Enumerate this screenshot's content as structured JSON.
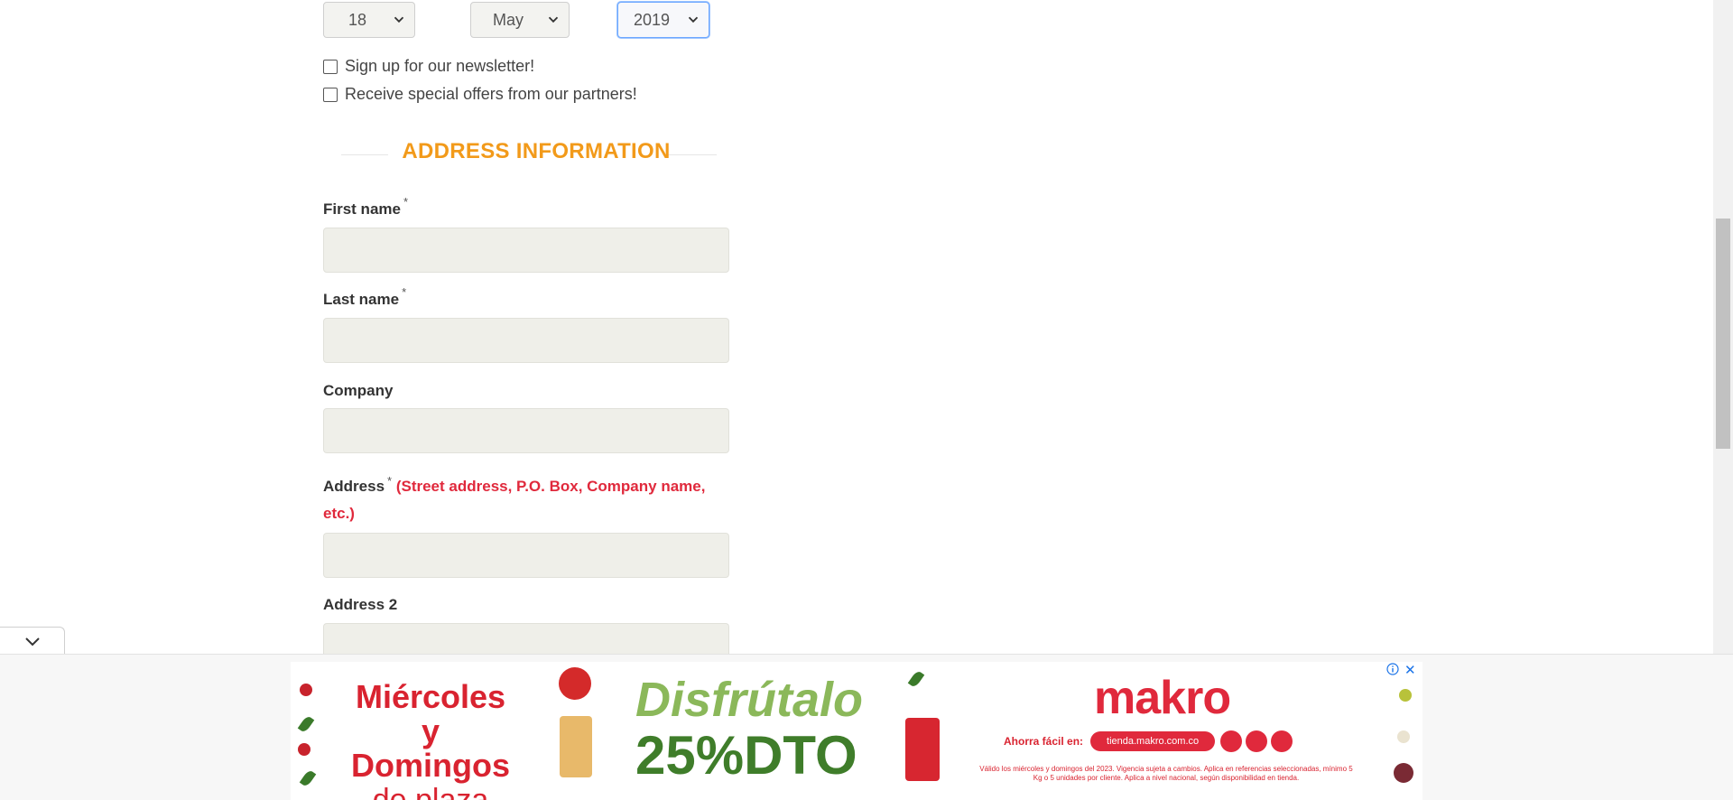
{
  "birthdate": {
    "day": "18",
    "month": "May",
    "year": "2019"
  },
  "checkboxes": {
    "newsletter_label": "Sign up for our newsletter!",
    "offers_label": "Receive special offers from our partners!"
  },
  "address_section": {
    "title": "ADDRESS INFORMATION",
    "required_mark": "*",
    "fields": {
      "first_name": "First name",
      "last_name": "Last name",
      "company": "Company",
      "address": "Address",
      "address_hint": "(Street address, P.O. Box, Company name, etc.)",
      "address2": "Address 2"
    }
  },
  "ad": {
    "line1": "Miércoles y",
    "line2": "Domingos",
    "line3": "de plaza",
    "headline": "Disfrútalo",
    "discount": "25%DTO",
    "brand": "makro",
    "order_label": "Ahorra fácil en:",
    "url": "tienda.makro.com.co",
    "fine_print": "Válido los miércoles y domingos del 2023. Vigencia sujeta a cambios. Aplica en referencias seleccionadas, mínimo 5 Kg o 5 unidades por cliente. Aplica a nivel nacional, según disponibilidad en tienda.",
    "close_symbol": "✕",
    "accent_color": "#e0293c"
  },
  "colors": {
    "section_title": "#f29a1a",
    "hint": "#e0293c",
    "input_bg": "#efefe9"
  }
}
